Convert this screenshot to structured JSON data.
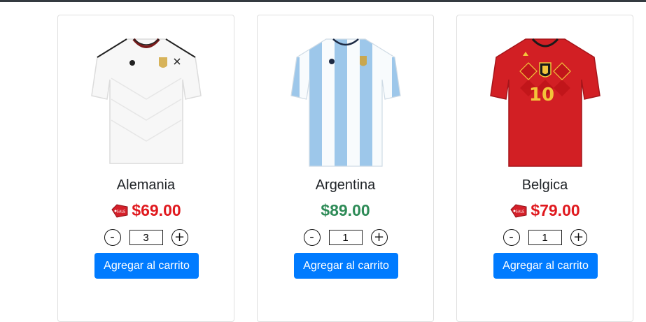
{
  "colors": {
    "accent": "#007bff",
    "sale_price": "#e0191e",
    "regular_price": "#2e8b57",
    "topbar": "#343a40"
  },
  "products": [
    {
      "name": "Alemania",
      "price": "$69.00",
      "on_sale": true,
      "quantity": "3",
      "decrement_label": "-",
      "increment_label": "+",
      "add_label": "Agregar al carrito",
      "sale_tag_text": "SALE",
      "image_icon": "germany-jersey"
    },
    {
      "name": "Argentina",
      "price": "$89.00",
      "on_sale": false,
      "quantity": "1",
      "decrement_label": "-",
      "increment_label": "+",
      "add_label": "Agregar al carrito",
      "image_icon": "argentina-jersey"
    },
    {
      "name": "Belgica",
      "price": "$79.00",
      "on_sale": true,
      "quantity": "1",
      "decrement_label": "-",
      "increment_label": "+",
      "add_label": "Agregar al carrito",
      "sale_tag_text": "SALE",
      "jersey_number": "10",
      "image_icon": "belgium-jersey"
    }
  ]
}
